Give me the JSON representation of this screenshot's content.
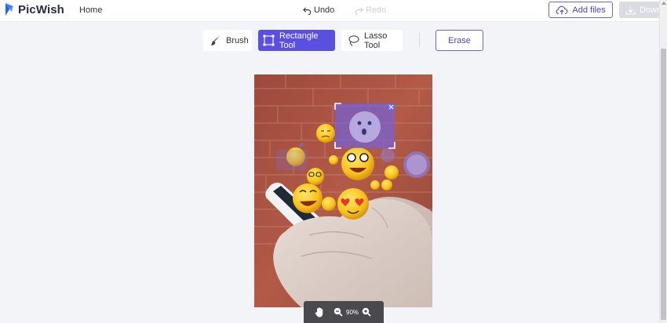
{
  "header": {
    "brand": "PicWish",
    "nav_home": "Home",
    "undo_label": "Undo",
    "redo_label": "Redo",
    "add_files_label": "Add files",
    "download_label": "Download"
  },
  "toolbar": {
    "brush_label": "Brush",
    "rect_label": "Rectangle Tool",
    "lasso_label": "Lasso Tool",
    "erase_label": "Erase",
    "active_tool": "Rectangle Tool"
  },
  "zoom": {
    "value": "90%"
  },
  "colors": {
    "accent": "#5a4fe0",
    "accent_outline": "#6c63e8",
    "selection_fill": "#6f63e6",
    "disabled": "#dadbe3"
  },
  "icons": [
    "undo-icon",
    "redo-icon",
    "cloud-upload-icon",
    "download-icon",
    "brush-icon",
    "rectangle-icon",
    "lasso-icon",
    "hand-icon",
    "zoom-out-icon",
    "zoom-in-icon",
    "close-icon"
  ]
}
